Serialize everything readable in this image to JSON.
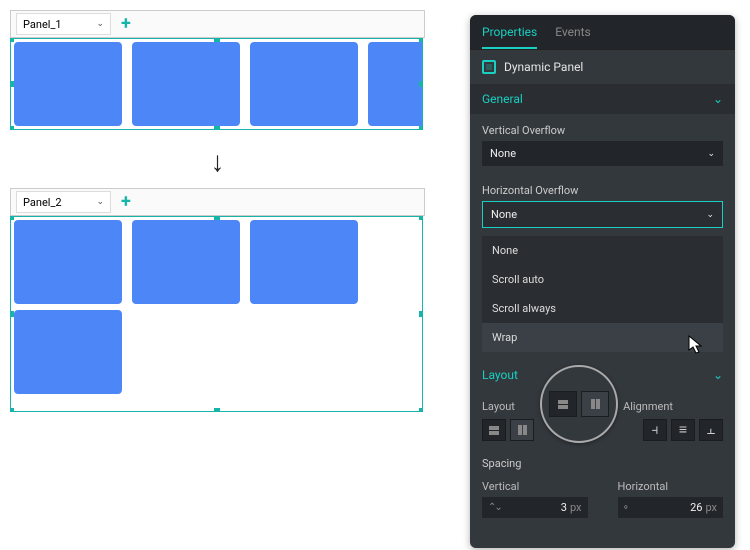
{
  "canvas": {
    "panel1_name": "Panel_1",
    "panel2_name": "Panel_2"
  },
  "tabs": {
    "properties": "Properties",
    "events": "Events"
  },
  "component_name": "Dynamic Panel",
  "sections": {
    "general": "General",
    "layout": "Layout"
  },
  "fields": {
    "v_overflow_label": "Vertical Overflow",
    "v_overflow_value": "None",
    "h_overflow_label": "Horizontal Overflow",
    "h_overflow_value": "None",
    "h_overflow_options": [
      "None",
      "Scroll auto",
      "Scroll always",
      "Wrap"
    ]
  },
  "layout": {
    "layout_label": "Layout",
    "alignment_label": "Alignment",
    "spacing_label": "Spacing",
    "vertical_label": "Vertical",
    "horizontal_label": "Horizontal",
    "vertical_value": "3",
    "horizontal_value": "26",
    "unit": "px"
  }
}
